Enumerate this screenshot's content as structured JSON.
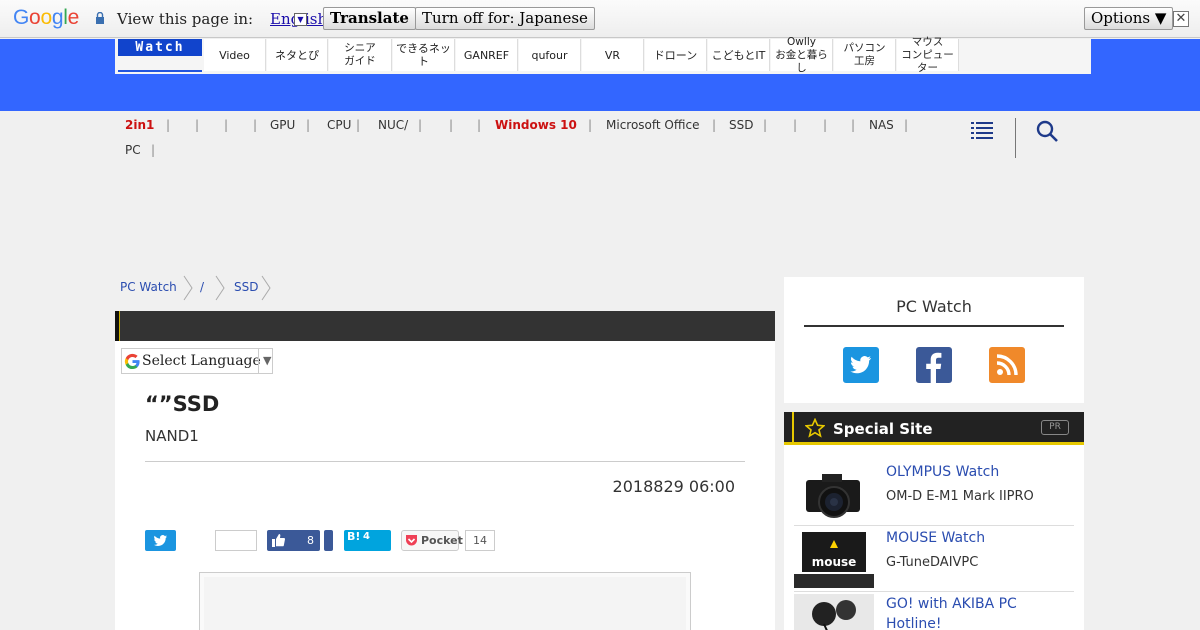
{
  "gbar": {
    "view_text": "View this page in:",
    "language": "English",
    "translate_label": "Translate",
    "turnoff_label": "Turn off for: Japanese",
    "options_label": "Options ▼",
    "close_label": "✕"
  },
  "header": {
    "logo": "Watch",
    "nav": [
      "Video",
      "ネタとぴ",
      "シニア\nガイド",
      "できるネット",
      "GANREF",
      "qufour",
      "VR",
      "ドローン",
      "こどもとIT",
      "Owlly\nお金と暮らし",
      "パソコン\n工房",
      "マウス\nコンピューター"
    ]
  },
  "categories": [
    {
      "label": "2in1",
      "red": true
    },
    {
      "label": "",
      "red": false
    },
    {
      "label": "",
      "red": false
    },
    {
      "label": "",
      "red": false
    },
    {
      "label": "GPU",
      "red": false
    },
    {
      "label": "CPU",
      "red": false
    },
    {
      "label": "NUC/",
      "red": false
    },
    {
      "label": "",
      "red": false
    },
    {
      "label": "",
      "red": false
    },
    {
      "label": "Windows 10",
      "red": true
    },
    {
      "label": "Microsoft Office",
      "red": false
    },
    {
      "label": "SSD",
      "red": false
    },
    {
      "label": "",
      "red": false
    },
    {
      "label": "",
      "red": false
    },
    {
      "label": "",
      "red": false
    },
    {
      "label": "NAS",
      "red": false
    },
    {
      "label": "PC",
      "red": false
    }
  ],
  "breadcrumb": [
    "PC Watch",
    "/",
    "SSD"
  ],
  "google_select": "Select Language",
  "article": {
    "title": "“”SSD",
    "subtitle": "NAND1",
    "date": "2018829 06:00",
    "fb_count": "8",
    "hb_count": "4",
    "pocket_label": "Pocket",
    "pocket_count": "14"
  },
  "sidebar": {
    "pcwatch_title": "PC Watch",
    "special_title": "Special Site",
    "pr": "PR",
    "items": [
      {
        "name": "OLYMPUS Watch",
        "desc": "OM-D E-M1 Mark IIPRO"
      },
      {
        "name": "MOUSE Watch",
        "desc": "G-TuneDAIVPC"
      },
      {
        "name": "GO! with AKIBA PC Hotline!",
        "desc": ""
      }
    ]
  },
  "colors": {
    "header_blue": "#3366ff",
    "twitter": "#1b95e0",
    "facebook": "#3b5998",
    "rss": "#f0892a",
    "accent_yellow": "#e6c800"
  }
}
